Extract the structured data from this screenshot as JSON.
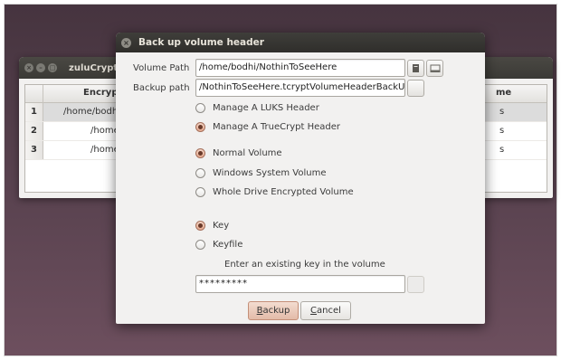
{
  "background_window": {
    "title": "zuluCrypt",
    "table": {
      "headers": [
        "Encrypte",
        "me"
      ],
      "rows": [
        {
          "num": "1",
          "path": "/home/bodhi",
          "tail": "s"
        },
        {
          "num": "2",
          "path": "/home",
          "tail": "s"
        },
        {
          "num": "3",
          "path": "/home",
          "tail": "s"
        }
      ]
    }
  },
  "dialog": {
    "title": "Back up volume header",
    "volume_path_label": "Volume Path",
    "volume_path_value": "/home/bodhi/NothinToSeeHere",
    "backup_path_label": "Backup path",
    "backup_path_value": "/NothinToSeeHere.tcryptVolumeHeaderBackUp",
    "header_options": [
      "Manage A LUKS Header",
      "Manage A TrueCrypt Header"
    ],
    "header_selected": 1,
    "volume_options": [
      "Normal Volume",
      "Windows System Volume",
      "Whole Drive Encrypted Volume"
    ],
    "volume_selected": 0,
    "key_options": [
      "Key",
      "Keyfile"
    ],
    "key_selected": 0,
    "key_prompt": "Enter an existing key in the volume",
    "key_value": "*********",
    "backup_button": {
      "accel": "B",
      "rest": "ackup"
    },
    "cancel_button": {
      "accel": "C",
      "rest": "ancel"
    },
    "icons": {
      "volume_file": "file-icon",
      "volume_drive": "drive-icon",
      "backup_browse": "browse-icon",
      "keyfile_browse": "keyfile-icon"
    }
  }
}
